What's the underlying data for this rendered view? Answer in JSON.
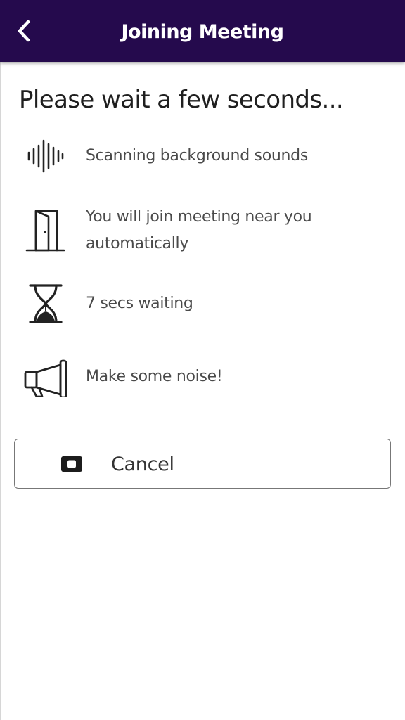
{
  "app_bar": {
    "title": "Joining Meeting",
    "back_icon": "chevron-left-icon",
    "background_color": "#250a4d"
  },
  "main": {
    "headline": "Please wait a few seconds...",
    "items": [
      {
        "icon": "sound-wave-icon",
        "text": "Scanning background sounds"
      },
      {
        "icon": "door-icon",
        "text": "You will join meeting near you automatically"
      },
      {
        "icon": "hourglass-icon",
        "text": "7 secs waiting"
      },
      {
        "icon": "megaphone-icon",
        "text": "Make some noise!"
      }
    ]
  },
  "cancel_button": {
    "label": "Cancel",
    "icon": "stop-icon"
  }
}
